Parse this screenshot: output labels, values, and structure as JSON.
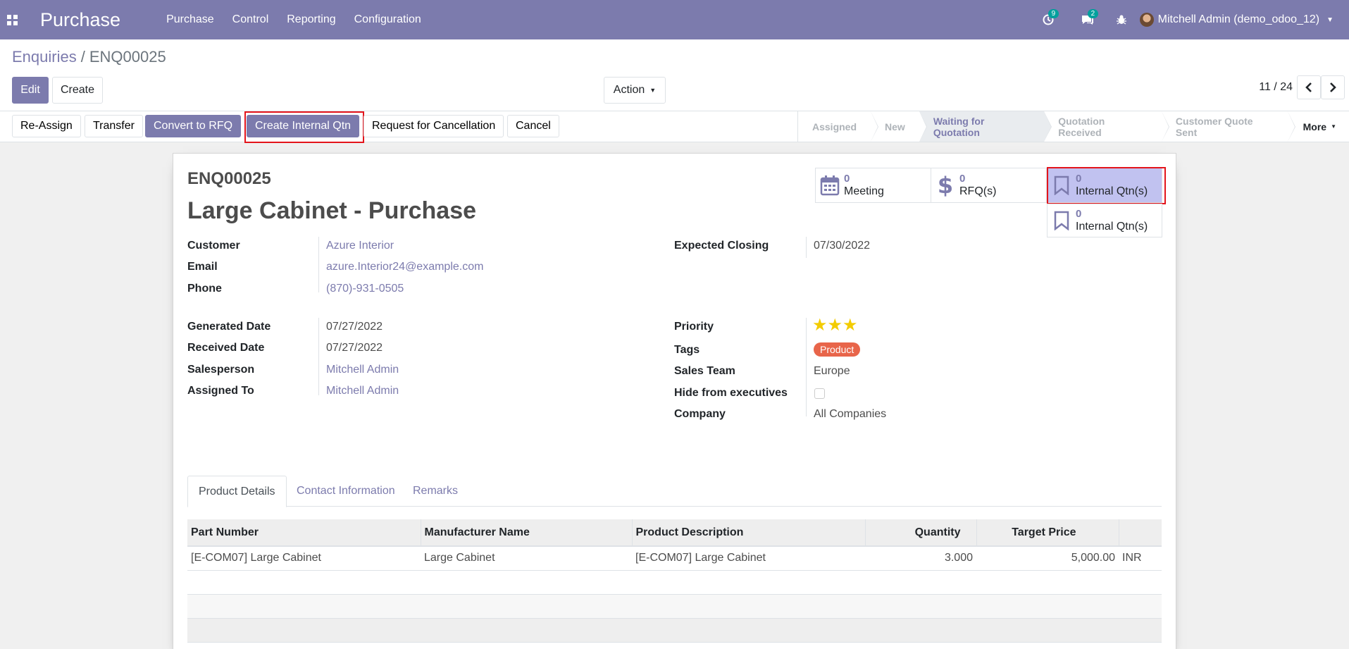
{
  "navbar": {
    "brand": "Purchase",
    "menu": [
      "Purchase",
      "Control",
      "Reporting",
      "Configuration"
    ],
    "activity_count": "9",
    "message_count": "2",
    "user": "Mitchell Admin (demo_odoo_12)"
  },
  "breadcrumb": {
    "parent": "Enquiries",
    "current": "ENQ00025"
  },
  "control": {
    "edit": "Edit",
    "create": "Create",
    "action": "Action",
    "pager": "11 / 24"
  },
  "statusbar": {
    "buttons": [
      "Re-Assign",
      "Transfer",
      "Convert to RFQ",
      "Create Internal Qtn",
      "Request for Cancellation",
      "Cancel"
    ],
    "stages": [
      "Assigned",
      "New",
      "Waiting for Quotation",
      "Quotation Received",
      "Customer Quote Sent"
    ],
    "active_stage": "Waiting for Quotation",
    "more": "More"
  },
  "form": {
    "ref": "ENQ00025",
    "title": "Large Cabinet - Purchase",
    "smart_buttons": [
      {
        "count": "0",
        "label": "Meeting",
        "icon": "calendar-icon"
      },
      {
        "count": "0",
        "label": "RFQ(s)",
        "icon": "dollar-icon"
      },
      {
        "count": "0",
        "label": "Internal Qtn(s)",
        "icon": "bookmark-icon"
      },
      {
        "count": "0",
        "label": "Internal Qtn(s)",
        "icon": "bookmark-icon"
      }
    ],
    "customer_label": "Customer",
    "customer": "Azure Interior",
    "email_label": "Email",
    "email": "azure.Interior24@example.com",
    "phone_label": "Phone",
    "phone": "(870)-931-0505",
    "expected_closing_label": "Expected Closing",
    "expected_closing": "07/30/2022",
    "generated_date_label": "Generated Date",
    "generated_date": "07/27/2022",
    "received_date_label": "Received Date",
    "received_date": "07/27/2022",
    "salesperson_label": "Salesperson",
    "salesperson": "Mitchell Admin",
    "assigned_to_label": "Assigned To",
    "assigned_to": "Mitchell Admin",
    "priority_label": "Priority",
    "priority_stars": 3,
    "tags_label": "Tags",
    "tag": "Product",
    "tag_color": "#e8654a",
    "sales_team_label": "Sales Team",
    "sales_team": "Europe",
    "hide_exec_label": "Hide from executives",
    "hide_exec": false,
    "company_label": "Company",
    "company": "All Companies"
  },
  "tabs": [
    "Product Details",
    "Contact Information",
    "Remarks"
  ],
  "lines": {
    "headers": [
      "Part Number",
      "Manufacturer Name",
      "Product Description",
      "Quantity",
      "Target Price"
    ],
    "rows": [
      {
        "part": "[E-COM07] Large Cabinet",
        "manufacturer": "Large Cabinet",
        "description": "[E-COM07] Large Cabinet",
        "quantity": "3.000",
        "price": "5,000.00",
        "currency": "INR"
      }
    ]
  },
  "colors": {
    "brand": "#7c7bad",
    "highlight": "#e3141b",
    "star": "#f3cc00"
  }
}
